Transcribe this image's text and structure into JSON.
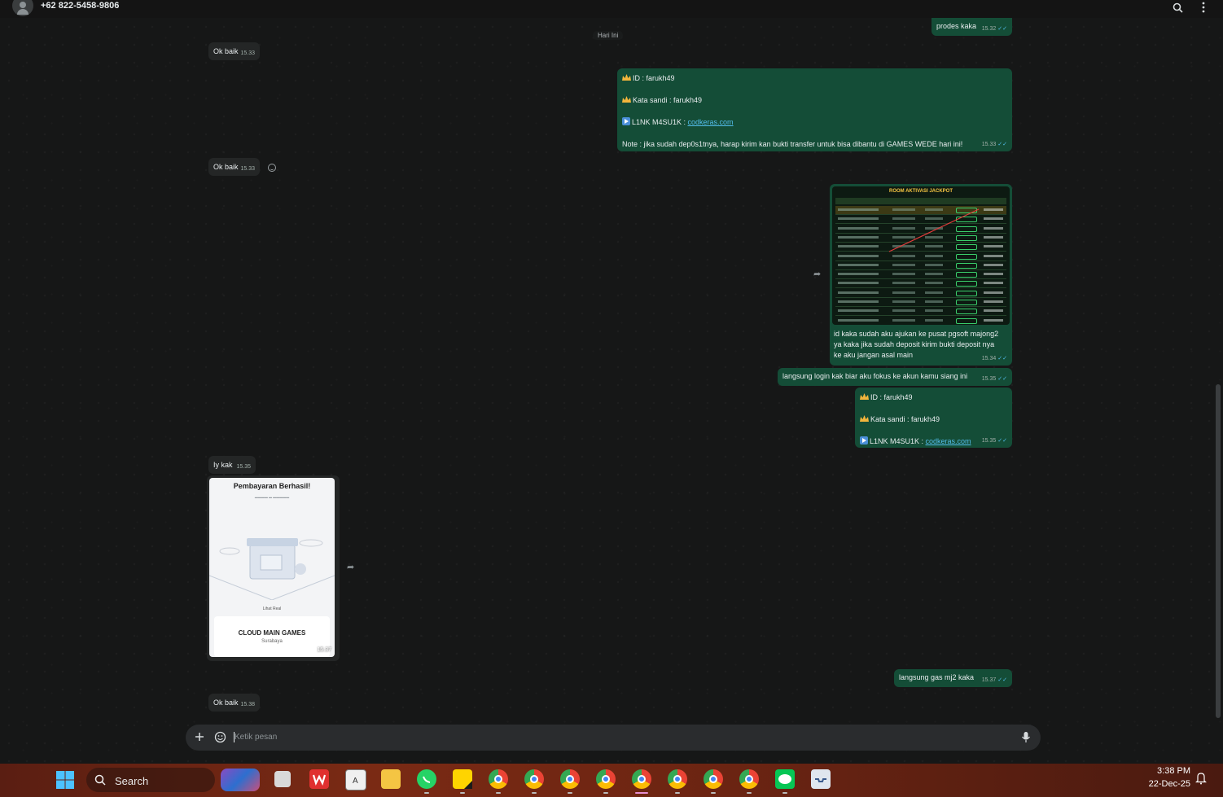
{
  "header": {
    "contact_name": "+62 822-5458-9806",
    "icons": [
      "search-icon",
      "more-vert-icon"
    ]
  },
  "chat": {
    "date_chip": "Hari Ini",
    "messages": [
      {
        "id": "m0",
        "dir": "out",
        "text": "prodes kaka",
        "time": "15.32",
        "read": true
      },
      {
        "id": "m1",
        "dir": "in",
        "text": "Ok baik",
        "time": "15.33"
      },
      {
        "id": "m2",
        "dir": "out",
        "line1": "ID :  farukh49",
        "line2": "Kata sandi : farukh49",
        "line3_label": "L1NK M4SU1K : ",
        "line3_link": "codkeras.com",
        "line4": "Note : jika sudah dep0s1tnya, harap kirim kan bukti transfer untuk bisa dibantu di GAMES WEDE hari ini!",
        "time": "15.33",
        "read": true
      },
      {
        "id": "m3",
        "dir": "in",
        "text": "Ok baik",
        "time": "15.33",
        "reaction": "smiley-icon"
      },
      {
        "id": "m4",
        "dir": "out",
        "image_title": "ROOM AKTIVASI JACKPOT",
        "caption": [
          "id kaka sudah aku ajukan ke pusat pgsoft majong2",
          "ya kaka jika sudah deposit kirim bukti deposit nya",
          "ke aku jangan asal main"
        ],
        "time": "15.34",
        "read": true
      },
      {
        "id": "m5",
        "dir": "out",
        "text": "langsung login kak biar aku fokus ke akun kamu siang ini",
        "time": "15.35",
        "read": true
      },
      {
        "id": "m6",
        "dir": "out",
        "line1": "ID :  farukh49",
        "line2": "Kata sandi : farukh49",
        "line3_label": "L1NK M4SU1K : ",
        "line3_link": "codkeras.com",
        "time": "15.35",
        "read": true
      },
      {
        "id": "m7",
        "dir": "in",
        "text": "Iy kak",
        "time": "15.35"
      },
      {
        "id": "m8",
        "dir": "in",
        "pay_title": "Pembayaran Berhasil!",
        "pay_link": "Lihat Real",
        "pay_merchant": "CLOUD MAIN GAMES",
        "pay_city": "Surabaya",
        "time": "15.37"
      },
      {
        "id": "m9",
        "dir": "out",
        "text": "langsung gas mj2 kaka",
        "time": "15.37",
        "read": true
      },
      {
        "id": "m10",
        "dir": "in",
        "text": "Ok baik",
        "time": "15.38"
      }
    ]
  },
  "composer": {
    "placeholder": "Ketik pesan"
  },
  "taskbar": {
    "search_label": "Search",
    "time": "3:38 PM",
    "date": "22-Dec-25"
  },
  "colors": {
    "incoming_bubble": "#242626",
    "outgoing_bubble": "#144d37",
    "link": "#53bdeb",
    "chat_bg": "#161717"
  }
}
